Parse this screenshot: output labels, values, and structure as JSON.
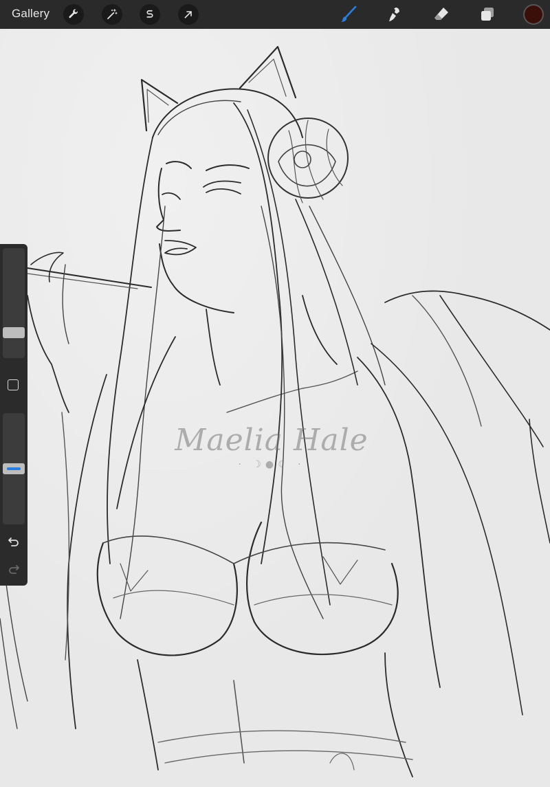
{
  "toolbar": {
    "gallery_label": "Gallery",
    "left_tools": [
      "wrench-icon",
      "magic-wand-icon",
      "selection-s-icon",
      "transform-arrow-icon"
    ],
    "right_tools": [
      "brush-icon",
      "smudge-icon",
      "eraser-icon",
      "layers-icon"
    ],
    "active_tool": "brush-icon",
    "brush_color": "#2a7de1",
    "current_color": "#3a0f0a"
  },
  "sidebar": {
    "size_level": 0.2,
    "opacity_level": 0.5,
    "icons": [
      "modify-square-icon",
      "undo-icon",
      "redo-icon"
    ]
  },
  "canvas": {
    "watermark_name": "Maelia Hale",
    "watermark_ornament": "· ☽●☾ ·"
  }
}
